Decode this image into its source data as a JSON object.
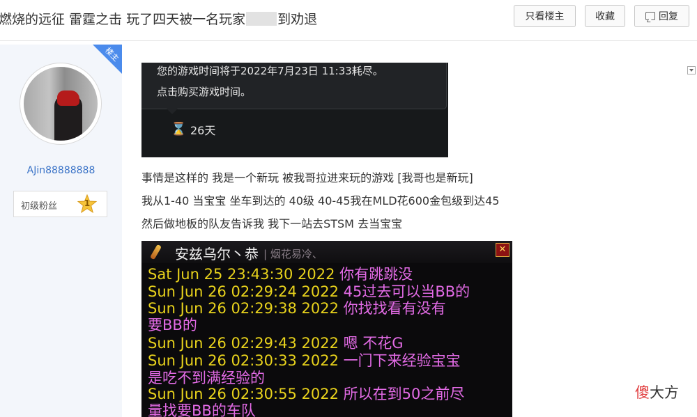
{
  "header": {
    "title_pre": "燃烧的远征 雷霆之击 玩了四天被一名玩家",
    "title_post": "到劝退",
    "btn_owner_only": "只看楼主",
    "btn_favorite": "收藏",
    "btn_reply": "回复"
  },
  "author": {
    "corner_badge": "楼主",
    "name": "AJin88888888",
    "fan_label": "初级粉丝",
    "fan_level": "1"
  },
  "post": {
    "game_tip": {
      "line1": "您的游戏时间将于2022年7月23日 11:33耗尽。",
      "line2": "点击购买游戏时间。",
      "hourglass": "⌛",
      "days": "26天"
    },
    "paragraphs": [
      "事情是这样的 我是一个新玩 被我哥拉进来玩的游戏 [我哥也是新玩]",
      "我从1-40 当宝宝 坐车到达的 40级 40-45我在MLD花600金包级到达45",
      "然后做地板的队友告诉我 我下一站去STSM 去当宝宝"
    ],
    "chat_window": {
      "sender": "安兹乌尔丶恭",
      "faint": "| 烟花易冷、",
      "close": "✕",
      "lines": [
        {
          "ts": "Sat Jun 25 23:43:30 2022 ",
          "msg": "你有跳跳没"
        },
        {
          "ts": "Sun Jun 26 02:29:24 2022 ",
          "msg": "45过去可以当BB的"
        },
        {
          "ts": "Sun Jun 26 02:29:38 2022 ",
          "msg": "你找找看有没有"
        },
        {
          "ts": "",
          "msg": "要BB的"
        },
        {
          "ts": "Sun Jun 26 02:29:43 2022 ",
          "msg": "嗯 不花G"
        },
        {
          "ts": "Sun Jun 26 02:30:33 2022 ",
          "msg": "一门下来经验宝宝"
        },
        {
          "ts": "",
          "msg": "是吃不到满经验的"
        },
        {
          "ts": "Sun Jun 26 02:30:55 2022 ",
          "msg": "所以在到50之前尽"
        },
        {
          "ts": "",
          "msg": "量找要BB的车队"
        }
      ]
    }
  },
  "watermark": {
    "part1": "傻",
    "part2": "大方"
  },
  "colors": {
    "accent": "#3a73c7",
    "badge": "#4b8bec",
    "chat_time": "#e8d21c",
    "chat_msg": "#e36be6"
  }
}
